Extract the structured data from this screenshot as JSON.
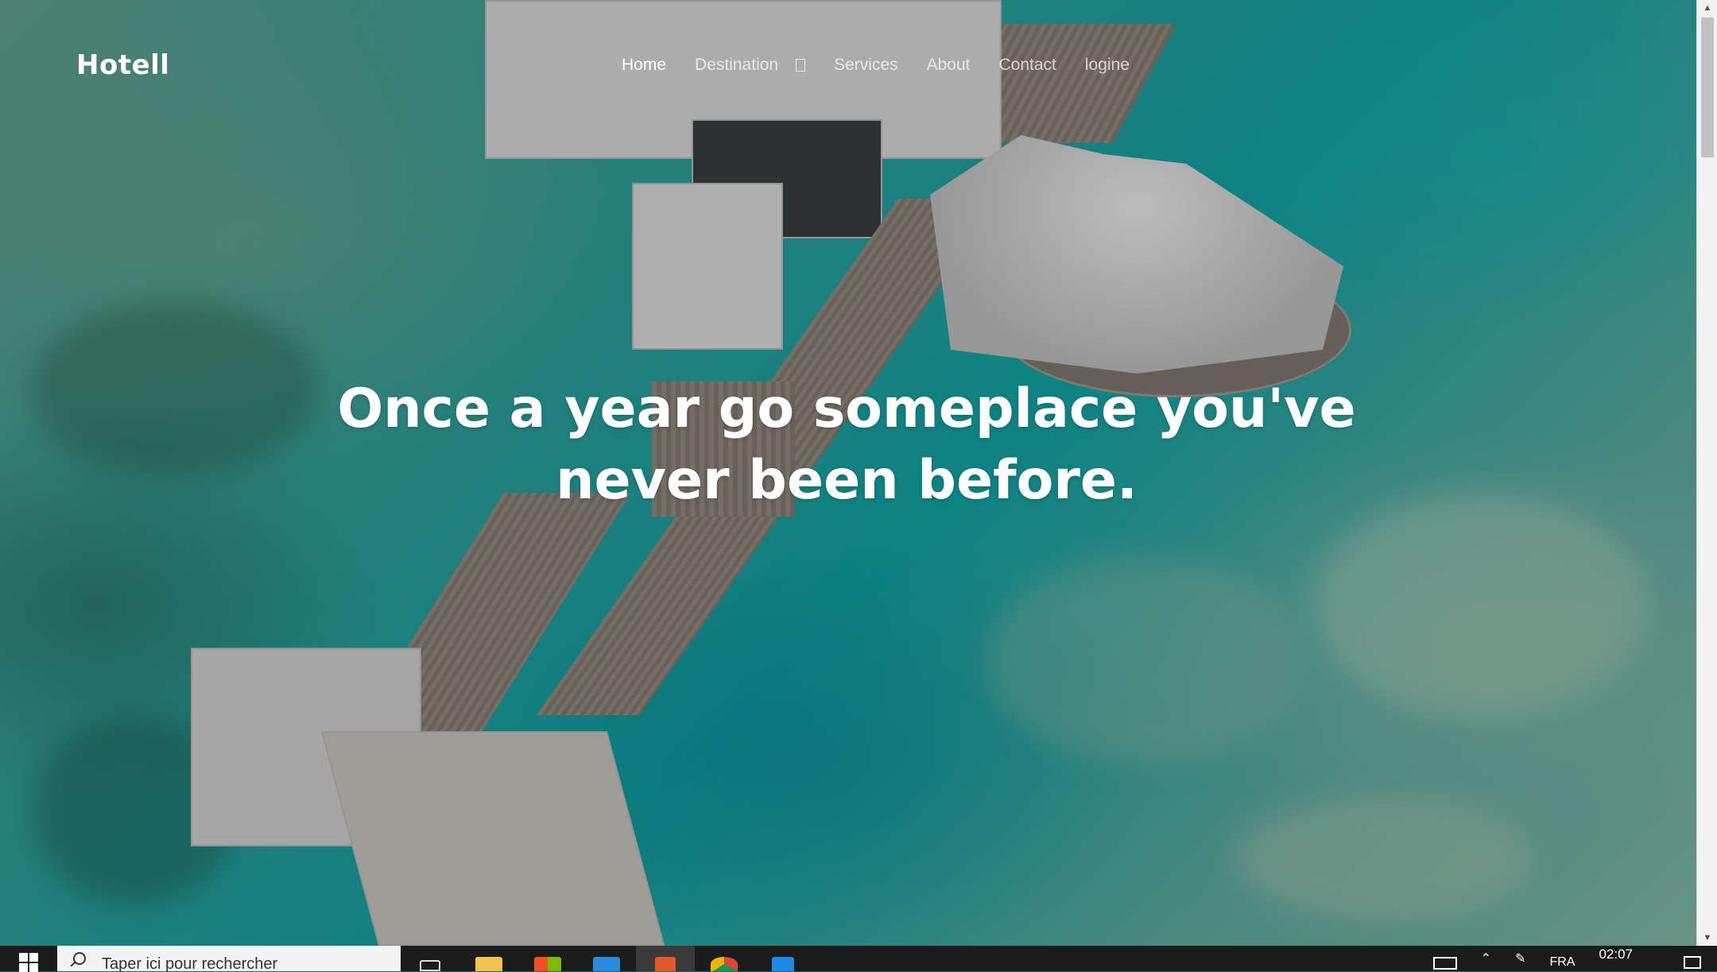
{
  "site": {
    "brand": "Hotell",
    "nav": [
      {
        "label": "Home",
        "active": true
      },
      {
        "label": "Destination",
        "active": false,
        "has_dropdown": true
      },
      {
        "label": "Services",
        "active": false
      },
      {
        "label": "About",
        "active": false
      },
      {
        "label": "Contact",
        "active": false
      },
      {
        "label": "logine",
        "active": false
      }
    ],
    "hero": {
      "line1": "Once a year go someplace you've",
      "line2": "never been before."
    }
  },
  "taskbar": {
    "search_placeholder": "Taper ici pour rechercher",
    "apps": [
      {
        "icon": "task-view-icon",
        "color": "#1b1b1b"
      },
      {
        "icon": "file-explorer-icon",
        "color": "#f2c14e"
      },
      {
        "icon": "microsoft-store-icon",
        "color": "#2f7bd8"
      },
      {
        "icon": "mail-icon",
        "color": "#2a8ae0"
      },
      {
        "icon": "brave-icon",
        "color": "#e25a2c"
      },
      {
        "icon": "chrome-icon",
        "color": "#db4437"
      },
      {
        "icon": "vscode-icon",
        "color": "#1e88e5"
      }
    ],
    "language": "FRA",
    "time": "02:07"
  },
  "colors": {
    "nav_active": "#ffffff",
    "nav_inactive": "rgba(255,255,255,0.72)",
    "taskbar_bg": "#1b1b1b"
  }
}
